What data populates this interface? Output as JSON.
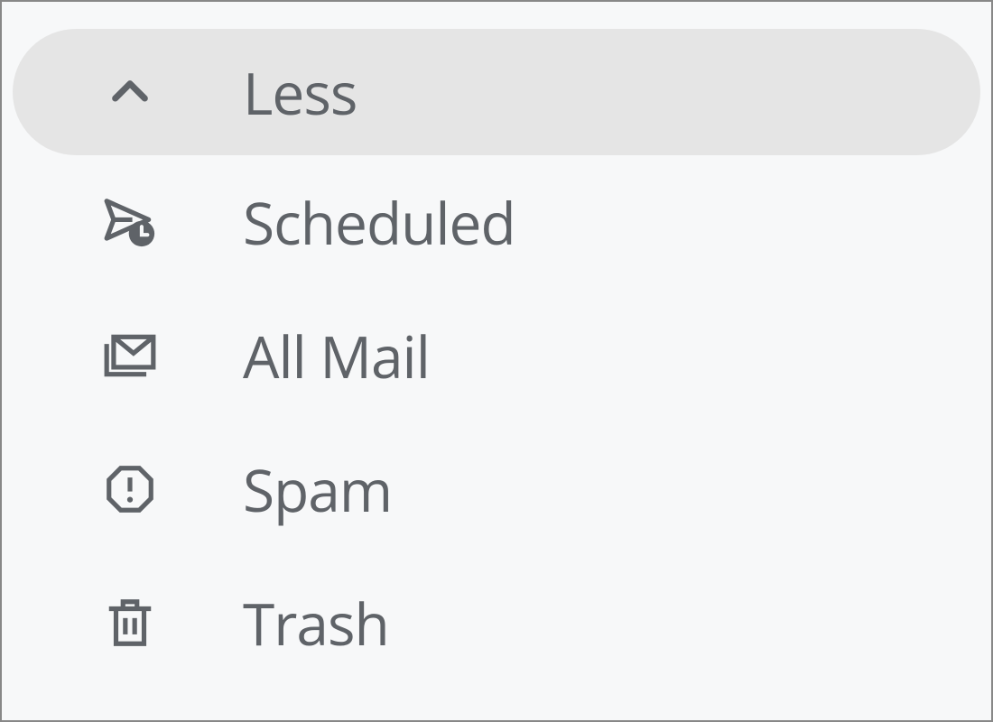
{
  "sidebar": {
    "collapse": {
      "label": "Less"
    },
    "items": [
      {
        "label": "Scheduled"
      },
      {
        "label": "All Mail"
      },
      {
        "label": "Spam"
      },
      {
        "label": "Trash"
      }
    ]
  }
}
